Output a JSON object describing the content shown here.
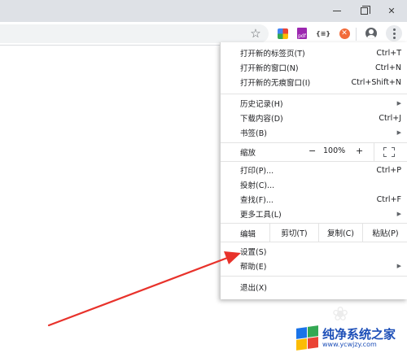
{
  "window": {
    "minimize_glyph": "",
    "close_glyph": "✕"
  },
  "toolbar": {
    "extensions": [
      "color-picker-extension",
      "pdf-extension",
      "json-viewer-extension",
      "adblock-extension"
    ],
    "ext2_text": "pdf",
    "ext3_text": "{≡}",
    "ext4_text": "✕"
  },
  "menu": {
    "new_tab": {
      "label": "打开新的标签页(T)",
      "shortcut": "Ctrl+T"
    },
    "new_window": {
      "label": "打开新的窗口(N)",
      "shortcut": "Ctrl+N"
    },
    "incognito": {
      "label": "打开新的无痕窗口(I)",
      "shortcut": "Ctrl+Shift+N"
    },
    "history": {
      "label": "历史记录(H)"
    },
    "downloads": {
      "label": "下载内容(D)",
      "shortcut": "Ctrl+J"
    },
    "bookmarks": {
      "label": "书签(B)"
    },
    "zoom": {
      "label": "缩放",
      "minus": "−",
      "value": "100%",
      "plus": "+"
    },
    "print": {
      "label": "打印(P)...",
      "shortcut": "Ctrl+P"
    },
    "cast": {
      "label": "投射(C)..."
    },
    "find": {
      "label": "查找(F)...",
      "shortcut": "Ctrl+F"
    },
    "more_tools": {
      "label": "更多工具(L)"
    },
    "edit": {
      "label": "编辑",
      "cut": "剪切(T)",
      "copy": "复制(C)",
      "paste": "粘贴(P)"
    },
    "settings": {
      "label": "设置(S)"
    },
    "help": {
      "label": "帮助(E)"
    },
    "exit": {
      "label": "退出(X)"
    }
  },
  "watermark": {
    "title": "纯净系统之家",
    "url": "www.ycwjzy.com"
  },
  "colors": {
    "annotation_arrow": "#e8322b",
    "watermark_blue": "#1d4fb8"
  }
}
